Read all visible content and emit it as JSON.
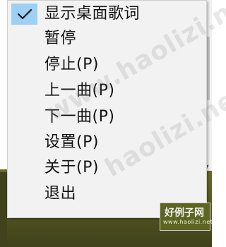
{
  "menu": {
    "items": [
      {
        "label": "显示桌面歌词",
        "checked": true
      },
      {
        "label": "暂停",
        "checked": false
      },
      {
        "label": "停止(P)",
        "checked": false
      },
      {
        "label": "上一曲(P)",
        "checked": false
      },
      {
        "label": "下一曲(P)",
        "checked": false
      },
      {
        "label": "设置(P)",
        "checked": false
      },
      {
        "label": "关于(P)",
        "checked": false
      },
      {
        "label": "退出",
        "checked": false
      }
    ]
  },
  "watermark": {
    "line1": "www.haolizi.net",
    "line2": "haolizi.net"
  },
  "logo": {
    "title": "好例子网",
    "subtitle": "www.haolizi.net"
  },
  "colors": {
    "menu_bg": "#f2f2f2",
    "check_highlight": "#9ecff4",
    "text": "#111111"
  }
}
